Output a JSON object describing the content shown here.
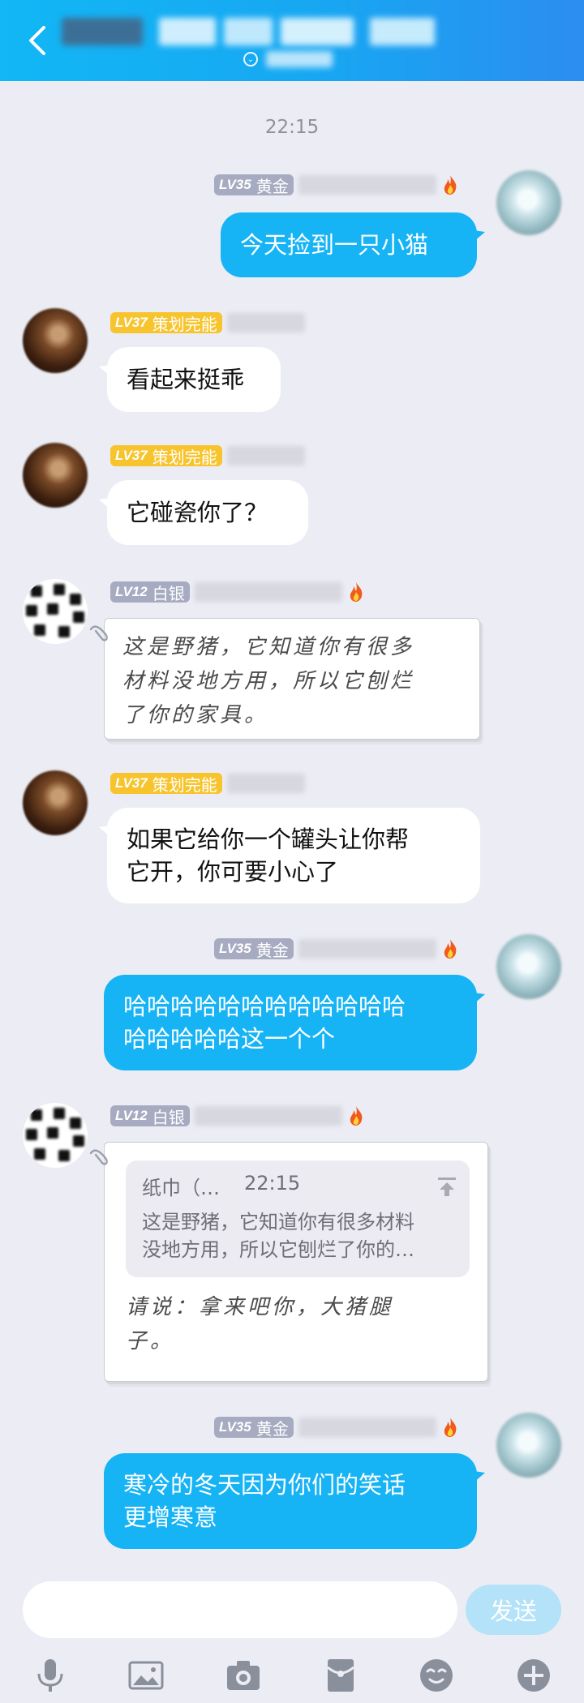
{
  "header": {
    "back_icon": "chevron-left-icon",
    "subtitle_icon": "chevron-down-circle-icon"
  },
  "timestamp": "22:15",
  "badges": {
    "gold": {
      "level": "LV35",
      "rank": "黄金"
    },
    "plan": {
      "level": "LV37",
      "rank": "策划完能"
    },
    "silver": {
      "level": "LV12",
      "rank": "白银"
    }
  },
  "messages": {
    "m1": "今天捡到一只小猫",
    "m2": "看起来挺乖",
    "m3": "它碰瓷你了？",
    "m4_lines": [
      "这是野猪，它知道你有很多",
      "材料没地方用，所以它刨烂",
      "了你的家具。"
    ],
    "m5_lines": [
      "如果它给你一个罐头让你帮",
      "它开，你可要小心了"
    ],
    "m6_lines": [
      "哈哈哈哈哈哈哈哈哈哈哈哈",
      "哈哈哈哈哈这一个个"
    ],
    "m7_quote": {
      "name": "纸巾（…",
      "time": "22:15",
      "lines": [
        "这是野猪，它知道你有很多材料",
        "没地方用，所以它刨烂了你的…"
      ]
    },
    "m7_lines": [
      "请说：拿来吧你，大猪腿",
      "子。"
    ],
    "m8_lines": [
      "寒冷的冬天因为你们的笑话",
      "更增寒意"
    ]
  },
  "composer": {
    "send_label": "发送",
    "input_value": ""
  },
  "colors": {
    "header": "#12b7f5",
    "bubble_blue": "#16b3f5",
    "background": "#ecedf4"
  }
}
